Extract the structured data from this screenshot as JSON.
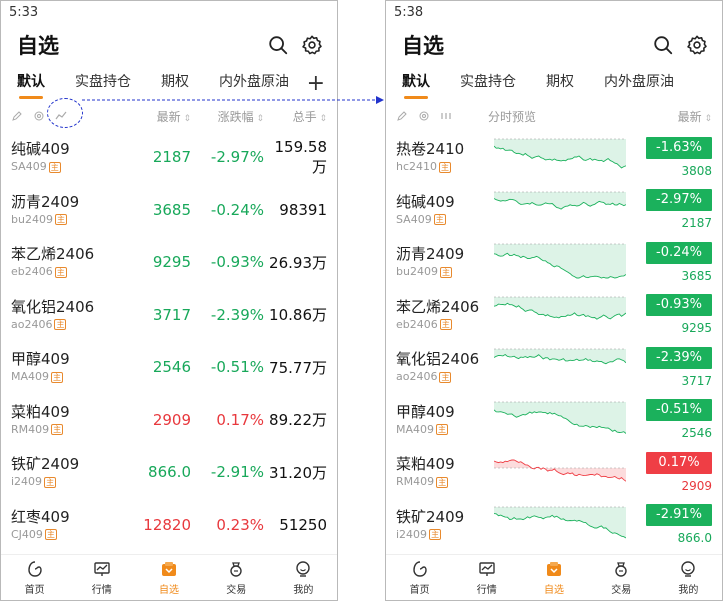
{
  "left": {
    "status_time": "5:33",
    "title": "自选",
    "tabs": [
      "默认",
      "实盘持仓",
      "期权",
      "内外盘原油"
    ],
    "headers": {
      "latest": "最新",
      "change": "涨跌幅",
      "volume": "总手"
    },
    "rows": [
      {
        "name": "纯碱409",
        "code": "SA409",
        "price": "2187",
        "change": "-2.97%",
        "volume": "159.58万",
        "dir": "down"
      },
      {
        "name": "沥青2409",
        "code": "bu2409",
        "price": "3685",
        "change": "-0.24%",
        "volume": "98391",
        "dir": "down"
      },
      {
        "name": "苯乙烯2406",
        "code": "eb2406",
        "price": "9295",
        "change": "-0.93%",
        "volume": "26.93万",
        "dir": "down"
      },
      {
        "name": "氧化铝2406",
        "code": "ao2406",
        "price": "3717",
        "change": "-2.39%",
        "volume": "10.86万",
        "dir": "down"
      },
      {
        "name": "甲醇409",
        "code": "MA409",
        "price": "2546",
        "change": "-0.51%",
        "volume": "75.77万",
        "dir": "down"
      },
      {
        "name": "菜粕409",
        "code": "RM409",
        "price": "2909",
        "change": "0.17%",
        "volume": "89.22万",
        "dir": "up"
      },
      {
        "name": "铁矿2409",
        "code": "i2409",
        "price": "866.0",
        "change": "-2.91%",
        "volume": "31.20万",
        "dir": "down"
      },
      {
        "name": "红枣409",
        "code": "CJ409",
        "price": "12820",
        "change": "0.23%",
        "volume": "51250",
        "dir": "up"
      }
    ]
  },
  "right": {
    "status_time": "5:38",
    "title": "自选",
    "tabs": [
      "默认",
      "实盘持仓",
      "期权",
      "内外盘原油"
    ],
    "headers": {
      "preview": "分时预览",
      "latest": "最新"
    },
    "rows": [
      {
        "name": "热卷2410",
        "code": "hc2410",
        "price": "3808",
        "change": "-1.63%",
        "dir": "down"
      },
      {
        "name": "纯碱409",
        "code": "SA409",
        "price": "2187",
        "change": "-2.97%",
        "dir": "down"
      },
      {
        "name": "沥青2409",
        "code": "bu2409",
        "price": "3685",
        "change": "-0.24%",
        "dir": "down"
      },
      {
        "name": "苯乙烯2406",
        "code": "eb2406",
        "price": "9295",
        "change": "-0.93%",
        "dir": "down"
      },
      {
        "name": "氧化铝2406",
        "code": "ao2406",
        "price": "3717",
        "change": "-2.39%",
        "dir": "down"
      },
      {
        "name": "甲醇409",
        "code": "MA409",
        "price": "2546",
        "change": "-0.51%",
        "dir": "down"
      },
      {
        "name": "菜粕409",
        "code": "RM409",
        "price": "2909",
        "change": "0.17%",
        "dir": "up"
      },
      {
        "name": "铁矿2409",
        "code": "i2409",
        "price": "866.0",
        "change": "-2.91%",
        "dir": "down"
      }
    ]
  },
  "tab_tag": "主",
  "tabbar": [
    {
      "label": "首页",
      "icon": "home-icon"
    },
    {
      "label": "行情",
      "icon": "market-chart-icon"
    },
    {
      "label": "自选",
      "icon": "watchlist-icon",
      "active": true
    },
    {
      "label": "交易",
      "icon": "trade-bag-icon"
    },
    {
      "label": "我的",
      "icon": "profile-icon"
    }
  ],
  "colors": {
    "up": "#e8383d",
    "down": "#18a85a",
    "accent": "#f08a1a",
    "annotation": "#2233cc"
  }
}
